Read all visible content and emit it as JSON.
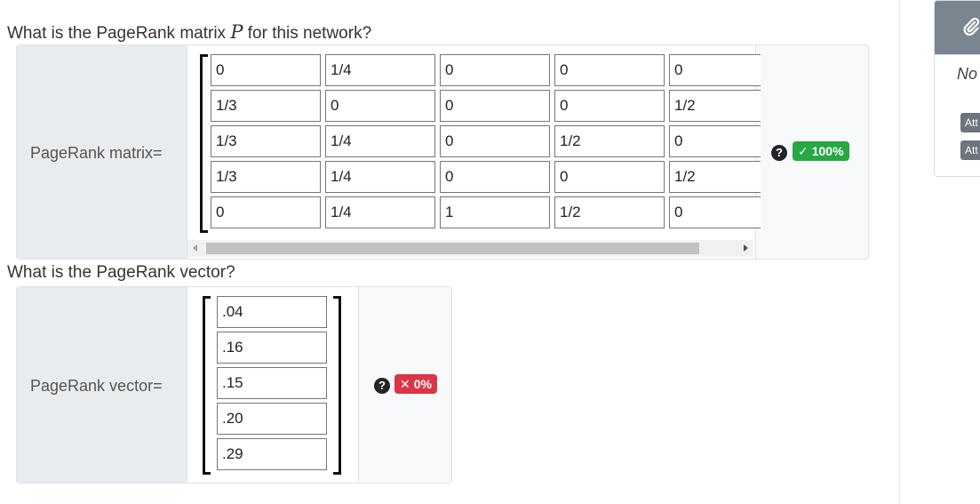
{
  "question1": {
    "prefix": "What is the PageRank matrix ",
    "math_symbol": "P",
    "suffix": " for this network?"
  },
  "matrix_card": {
    "label": "PageRank matrix=",
    "rows": [
      [
        "0",
        "1/4",
        "0",
        "0",
        "0"
      ],
      [
        "1/3",
        "0",
        "0",
        "0",
        "1/2"
      ],
      [
        "1/3",
        "1/4",
        "0",
        "1/2",
        "0"
      ],
      [
        "1/3",
        "1/4",
        "0",
        "0",
        "1/2"
      ],
      [
        "0",
        "1/4",
        "1",
        "1/2",
        "0"
      ]
    ],
    "help_icon": "question-circle-icon",
    "badge": {
      "mark": "✓",
      "text": "100%",
      "color": "#28a745"
    }
  },
  "question2": {
    "text": "What is the PageRank vector?"
  },
  "vector_card": {
    "label": "PageRank vector=",
    "values": [
      ".04",
      ".16",
      ".15",
      ".20",
      ".29"
    ],
    "help_icon": "question-circle-icon",
    "badge": {
      "mark": "✕",
      "text": "0%",
      "color": "#dc3545"
    }
  },
  "sidebar": {
    "header_icon": "paperclip-icon",
    "no_text": "No",
    "buttons": [
      "Att",
      "Att"
    ]
  }
}
